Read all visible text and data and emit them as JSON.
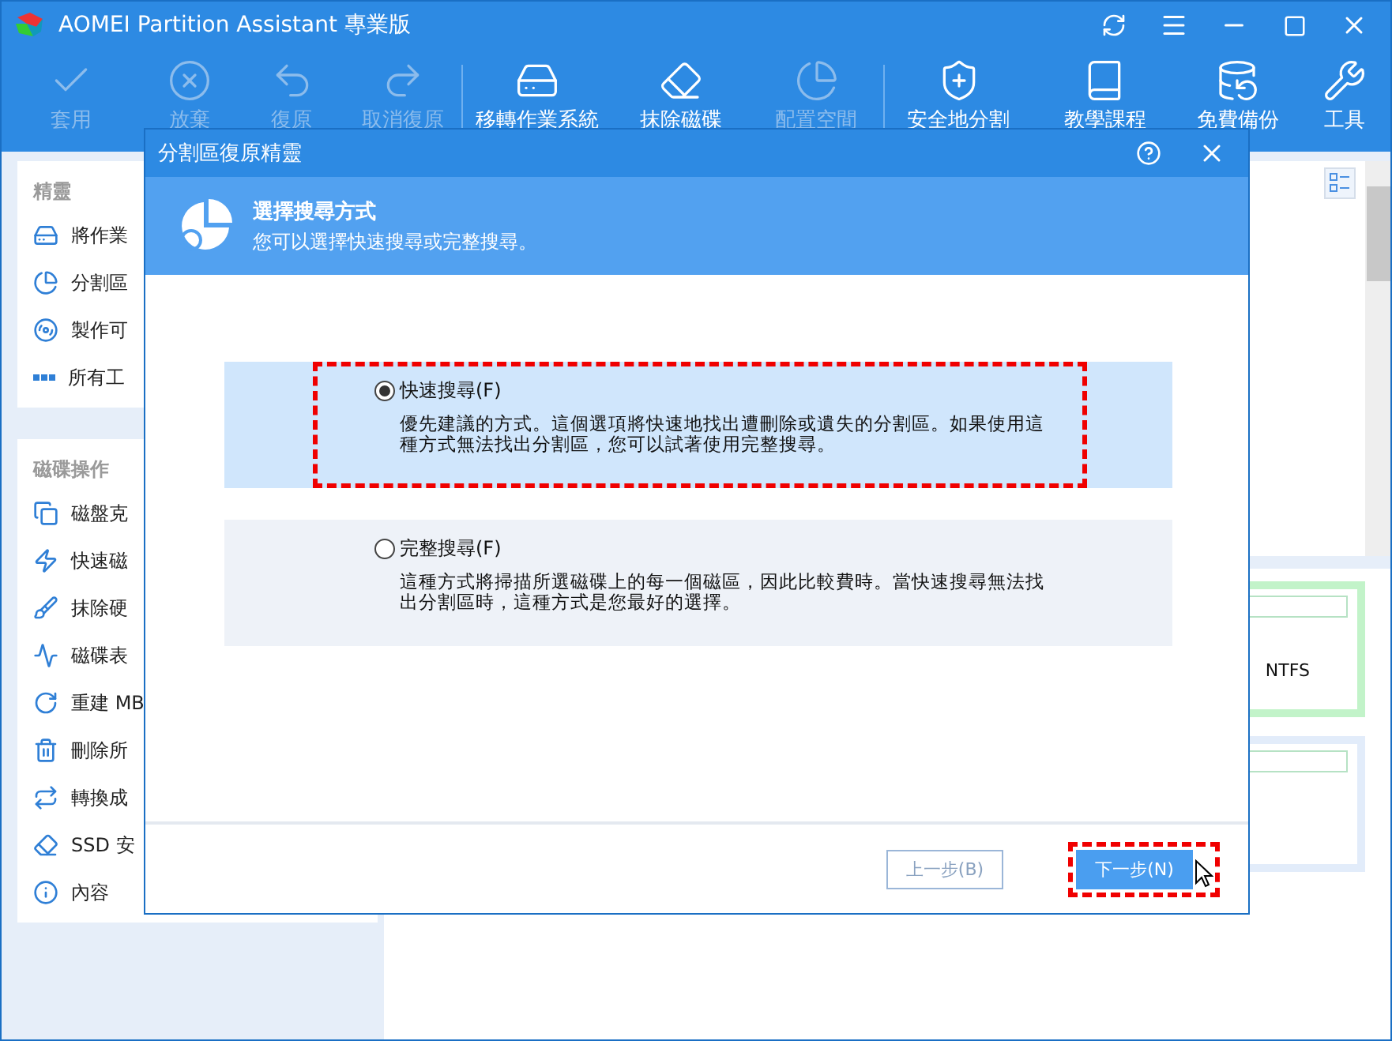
{
  "window": {
    "title": "AOMEI Partition Assistant 專業版"
  },
  "toolbar": [
    {
      "label": "套用",
      "disabled": true
    },
    {
      "label": "放棄",
      "disabled": true
    },
    {
      "label": "復原",
      "disabled": true
    },
    {
      "label": "取消復原",
      "disabled": true
    },
    {
      "label": "移轉作業系統",
      "disabled": false
    },
    {
      "label": "抹除磁碟",
      "disabled": false
    },
    {
      "label": "配置空間",
      "disabled": true
    },
    {
      "label": "安全地分割",
      "disabled": false
    },
    {
      "label": "教學課程",
      "disabled": false
    },
    {
      "label": "免費備份",
      "disabled": false
    },
    {
      "label": "工具",
      "disabled": false
    }
  ],
  "sidebar": [
    {
      "title": "精靈",
      "items": [
        "將作業",
        "分割區",
        "製作可",
        "所有工"
      ]
    },
    {
      "title": "磁碟操作",
      "items": [
        "磁盤克",
        "快速磁",
        "抹除硬",
        "磁碟表",
        "重建 MB",
        "刪除所",
        "轉換成",
        "SSD 安",
        "內容"
      ]
    }
  ],
  "disk_map": {
    "partition_label": "NTFS"
  },
  "dialog": {
    "title": "分割區復原精靈",
    "heading": "選擇搜尋方式",
    "subheading": "您可以選擇快速搜尋或完整搜尋。",
    "options": [
      {
        "label": "快速搜尋(F)",
        "description": "優先建議的方式。這個選項將快速地找出遭刪除或遺失的分割區。如果使用這種方式無法找出分割區，您可以試著使用完整搜尋。",
        "selected": true,
        "highlighted": true
      },
      {
        "label": "完整搜尋(F)",
        "description": "這種方式將掃描所選磁碟上的每一個磁區，因此比較費時。當快速搜尋無法找出分割區時，這種方式是您最好的選擇。",
        "selected": false,
        "highlighted": false
      }
    ],
    "buttons": [
      {
        "label": "上一步(B)",
        "disabled": true,
        "highlighted": false
      },
      {
        "label": "下一步(N)",
        "disabled": false,
        "highlighted": true
      }
    ]
  }
}
